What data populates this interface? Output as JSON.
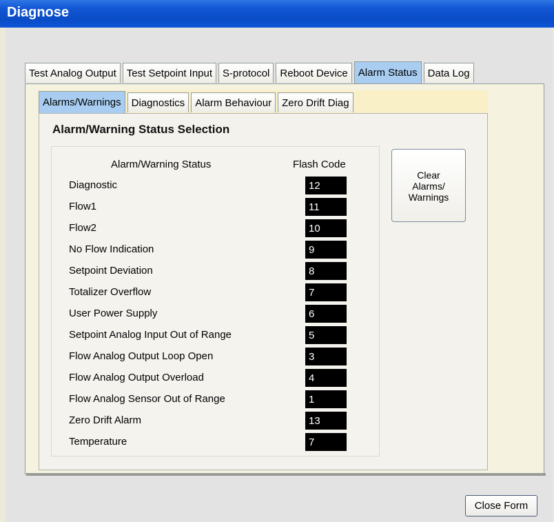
{
  "window": {
    "title": "Diagnose"
  },
  "outer_tabs": [
    {
      "label": "Test Analog Output"
    },
    {
      "label": "Test Setpoint Input"
    },
    {
      "label": "S-protocol"
    },
    {
      "label": "Reboot Device"
    },
    {
      "label": "Alarm Status",
      "active": true
    },
    {
      "label": "Data Log"
    }
  ],
  "inner_tabs": [
    {
      "label": "Alarms/Warnings",
      "active": true
    },
    {
      "label": "Diagnostics"
    },
    {
      "label": "Alarm Behaviour"
    },
    {
      "label": "Zero Drift Diag"
    }
  ],
  "section": {
    "title": "Alarm/Warning Status Selection"
  },
  "table": {
    "header_status": "Alarm/Warning Status",
    "header_code": "Flash Code",
    "rows": [
      {
        "label": "Diagnostic",
        "code": "12"
      },
      {
        "label": "Flow1",
        "code": "11"
      },
      {
        "label": "Flow2",
        "code": "10"
      },
      {
        "label": "No Flow Indication",
        "code": "9"
      },
      {
        "label": "Setpoint Deviation",
        "code": "8"
      },
      {
        "label": "Totalizer Overflow",
        "code": "7"
      },
      {
        "label": "User Power Supply",
        "code": "6"
      },
      {
        "label": "Setpoint Analog Input Out of Range",
        "code": "5"
      },
      {
        "label": "Flow Analog Output Loop Open",
        "code": "3"
      },
      {
        "label": "Flow Analog Output Overload",
        "code": "4"
      },
      {
        "label": "Flow Analog Sensor Out of Range",
        "code": "1"
      },
      {
        "label": "Zero Drift Alarm",
        "code": "13"
      },
      {
        "label": "Temperature",
        "code": "7"
      }
    ]
  },
  "buttons": {
    "clear_line1": "Clear",
    "clear_line2": "Alarms/",
    "clear_line3": "Warnings",
    "close": "Close Form"
  },
  "colors": {
    "title_bar": "#0a4cc6",
    "active_tab": "#a8cdf1",
    "code_box": "#000000"
  }
}
